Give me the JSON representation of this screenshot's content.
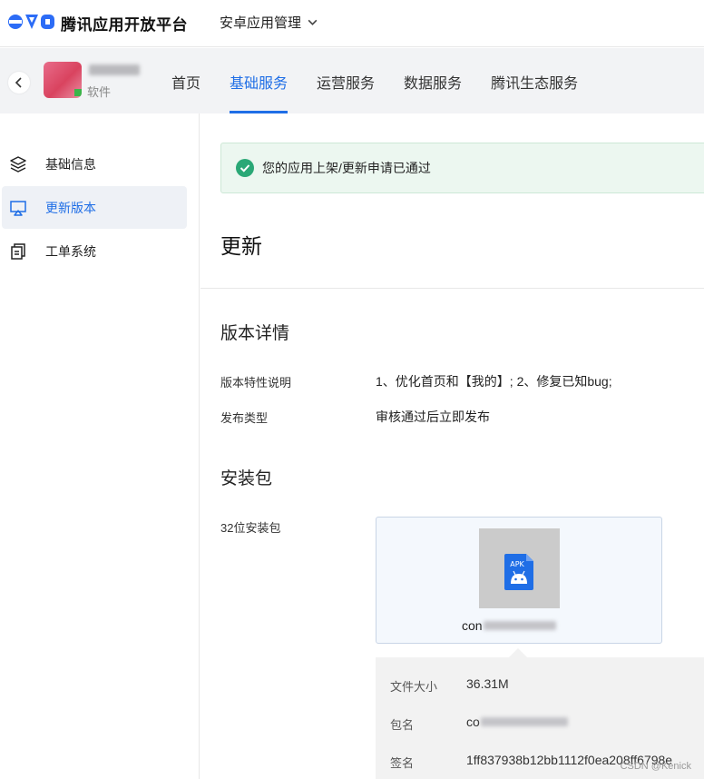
{
  "header": {
    "brand": "腾讯应用开放平台",
    "app_management": "安卓应用管理",
    "colors": {
      "accent": "#1f6ee6",
      "logo": "#2c6cf6"
    }
  },
  "app": {
    "type": "软件"
  },
  "nav": {
    "tabs": [
      {
        "label": "首页",
        "active": false
      },
      {
        "label": "基础服务",
        "active": true
      },
      {
        "label": "运营服务",
        "active": false
      },
      {
        "label": "数据服务",
        "active": false
      },
      {
        "label": "腾讯生态服务",
        "active": false
      }
    ]
  },
  "sidebar": {
    "items": [
      {
        "label": "基础信息",
        "icon": "layers-icon",
        "active": false
      },
      {
        "label": "更新版本",
        "icon": "monitor-icon",
        "active": true
      },
      {
        "label": "工单系统",
        "icon": "copy-document-icon",
        "active": false
      }
    ]
  },
  "notice": {
    "text": "您的应用上架/更新申请已通过",
    "color": "#2aa876"
  },
  "main": {
    "title": "更新",
    "version_section": "版本详情",
    "release_notes_label": "版本特性说明",
    "release_notes_value": "1、优化首页和【我的】; 2、修复已知bug;",
    "release_type_label": "发布类型",
    "release_type_value": "审核通过后立即发布",
    "package_section": "安装包",
    "package_32_label": "32位安装包"
  },
  "apk": {
    "badge": "APK",
    "name_prefix": "con",
    "details": {
      "file_size_label": "文件大小",
      "file_size_value": "36.31M",
      "package_label": "包名",
      "package_prefix": "co",
      "signature_label": "签名",
      "signature_value": "1ff837938b12bb1112f0ea208ff6798e"
    }
  },
  "watermark": "CSDN @Kenick"
}
